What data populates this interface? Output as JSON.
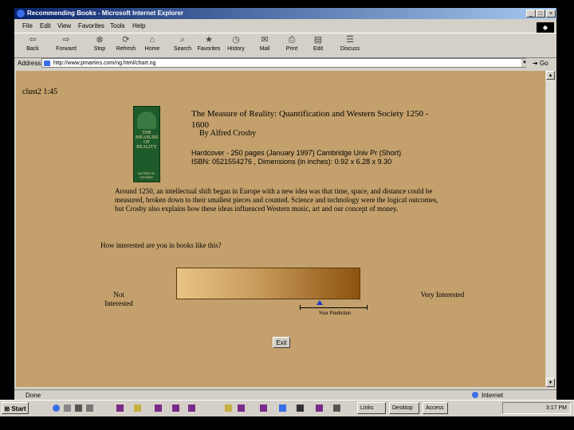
{
  "window": {
    "title": "Recommending Books - Microsoft Internet Explorer",
    "controls": [
      "_",
      "□",
      "×"
    ]
  },
  "menu": [
    "File",
    "Edit",
    "View",
    "Favorites",
    "Tools",
    "Help"
  ],
  "toolbar": {
    "back": "Back",
    "forward": "Forward",
    "stop": "Stop",
    "refresh": "Refresh",
    "home": "Home",
    "search": "Search",
    "favorites": "Favorites",
    "history": "History",
    "mail": "Mail",
    "print": "Print",
    "edit": "Edit",
    "discuss": "Discuss"
  },
  "address": {
    "label": "Address",
    "value": "http://www.pmartins.com/ng.html/chart.ng",
    "go": "Go"
  },
  "page": {
    "clock": "clust2 1:45",
    "cover": {
      "title_text": "THE MEASURE OF REALITY",
      "author_text": "ALFRED W. CROSBY"
    },
    "book_title": "The Measure of Reality: Quantification and Western Society 1250 - 1600",
    "author": "By Alfred Crosby",
    "meta_line1": "Hardcover - 250 pages (January 1997) Cambridge Univ Pr (Short)",
    "meta_line2": "ISBN: 0521554276 , Dimensions (in inches): 0.92 x 6.28 x 9.30",
    "description": "Around 1250, an intellectual shift began in Europe with a new idea was that time, space, and distance could be measured, broken down to their smallest pieces and counted. Science and technology were the logical outcomes, but Crosby also explains how these ideas influenced Western music, art and our concept of money.",
    "question": "How interested are you in books like this?",
    "low_label": "Not Interested",
    "high_label": "Very Interested",
    "indicator_label": "Your Prediction",
    "prediction_position": 0.78,
    "exit": "Exit"
  },
  "status": {
    "text": "Done",
    "zone": "Internet"
  },
  "taskbar": {
    "start": "Start",
    "tasks": [
      "Links",
      "Desktop",
      "Access"
    ],
    "time": "3:17 PM"
  }
}
